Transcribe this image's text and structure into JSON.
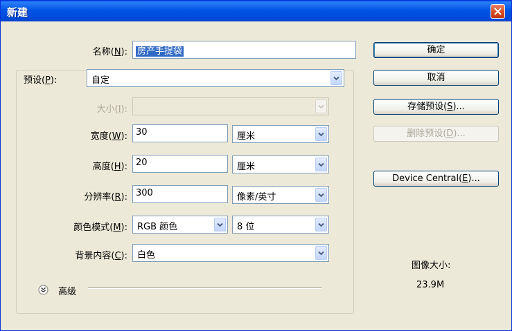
{
  "window": {
    "title": "新建"
  },
  "form": {
    "name": {
      "label_pre": "名称(",
      "key": "N",
      "label_post": "):",
      "value": "房产手提袋"
    },
    "preset": {
      "label_pre": "预设(",
      "key": "P",
      "label_post": "):",
      "value": "自定"
    },
    "size": {
      "label_pre": "大小(",
      "key": "I",
      "label_post": "):",
      "value": ""
    },
    "width": {
      "label_pre": "宽度(",
      "key": "W",
      "label_post": "):",
      "value": "30",
      "unit": "厘米"
    },
    "height": {
      "label_pre": "高度(",
      "key": "H",
      "label_post": "):",
      "value": "20",
      "unit": "厘米"
    },
    "resolution": {
      "label_pre": "分辨率(",
      "key": "R",
      "label_post": "):",
      "value": "300",
      "unit": "像素/英寸"
    },
    "color_mode": {
      "label_pre": "颜色模式(",
      "key": "M",
      "label_post": "):",
      "mode": "RGB 颜色",
      "depth": "8 位"
    },
    "background": {
      "label_pre": "背景内容(",
      "key": "C",
      "label_post": "):",
      "value": "白色"
    },
    "advanced": {
      "label": "高级"
    }
  },
  "buttons": {
    "ok": "确定",
    "cancel": "取消",
    "save_preset": {
      "pre": "存储预设(",
      "key": "S",
      "post": ")..."
    },
    "delete_preset": {
      "pre": "删除预设(",
      "key": "D",
      "post": ")..."
    },
    "device_central": {
      "pre": "Device Central(",
      "key": "E",
      "post": ")..."
    }
  },
  "image_size": {
    "label": "图像大小:",
    "value": "23.9M"
  },
  "icons": {
    "close": "close-icon",
    "dropdown": "chevron-down-icon",
    "advanced": "double-chevron-down-icon"
  }
}
